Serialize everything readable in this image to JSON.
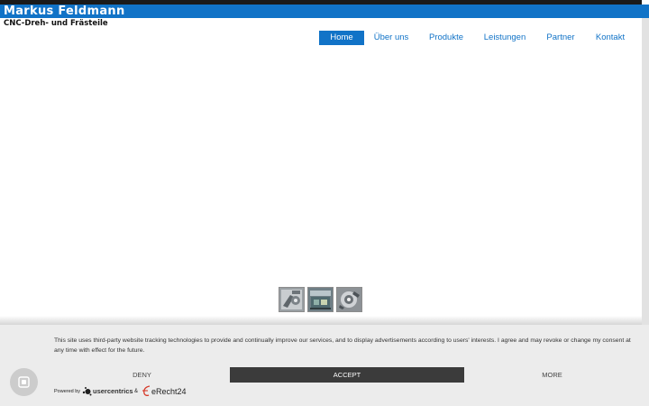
{
  "header": {
    "logo_title": "Markus Feldmann",
    "logo_subtitle": "CNC-Dreh- und Frästeile"
  },
  "nav": {
    "items": [
      {
        "label": "Home",
        "active": true
      },
      {
        "label": "Über uns",
        "active": false
      },
      {
        "label": "Produkte",
        "active": false
      },
      {
        "label": "Leistungen",
        "active": false
      },
      {
        "label": "Partner",
        "active": false
      },
      {
        "label": "Kontakt",
        "active": false
      }
    ]
  },
  "gallery": {
    "thumbnails": [
      "cnc-part-photo-1",
      "cnc-part-photo-2",
      "cnc-part-photo-3"
    ]
  },
  "cookie_banner": {
    "text": "This site uses third-party website tracking technologies to provide and continually improve our services, and to display advertisements according to users' interests. I agree and may revoke or change my consent at any time with effect for the future.",
    "deny_label": "DENY",
    "accept_label": "ACCEPT",
    "more_label": "MORE",
    "powered_by": "Powered by",
    "usercentrics": "usercentrics",
    "ampersand": "&",
    "erecht": "eRecht24"
  },
  "privacy_button": {
    "icon": "fingerprint-icon"
  },
  "colors": {
    "brand_blue": "#1173c7",
    "accept_bg": "#3b3b3b",
    "banner_bg": "#ececec"
  }
}
